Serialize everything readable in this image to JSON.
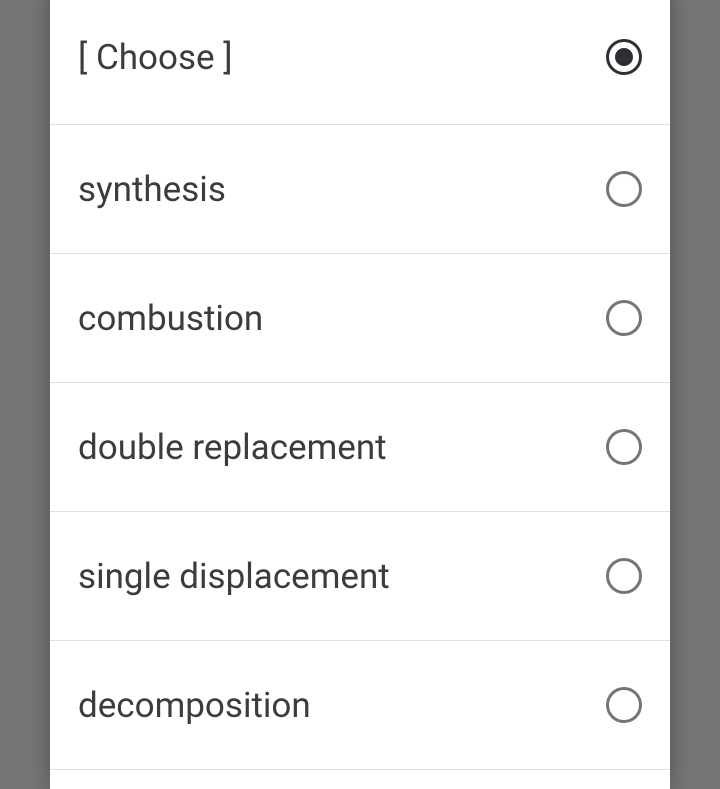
{
  "options": [
    {
      "label": "[ Choose ]",
      "selected": true
    },
    {
      "label": "synthesis",
      "selected": false
    },
    {
      "label": "combustion",
      "selected": false
    },
    {
      "label": "double replacement",
      "selected": false
    },
    {
      "label": "single displacement",
      "selected": false
    },
    {
      "label": "decomposition",
      "selected": false
    }
  ]
}
